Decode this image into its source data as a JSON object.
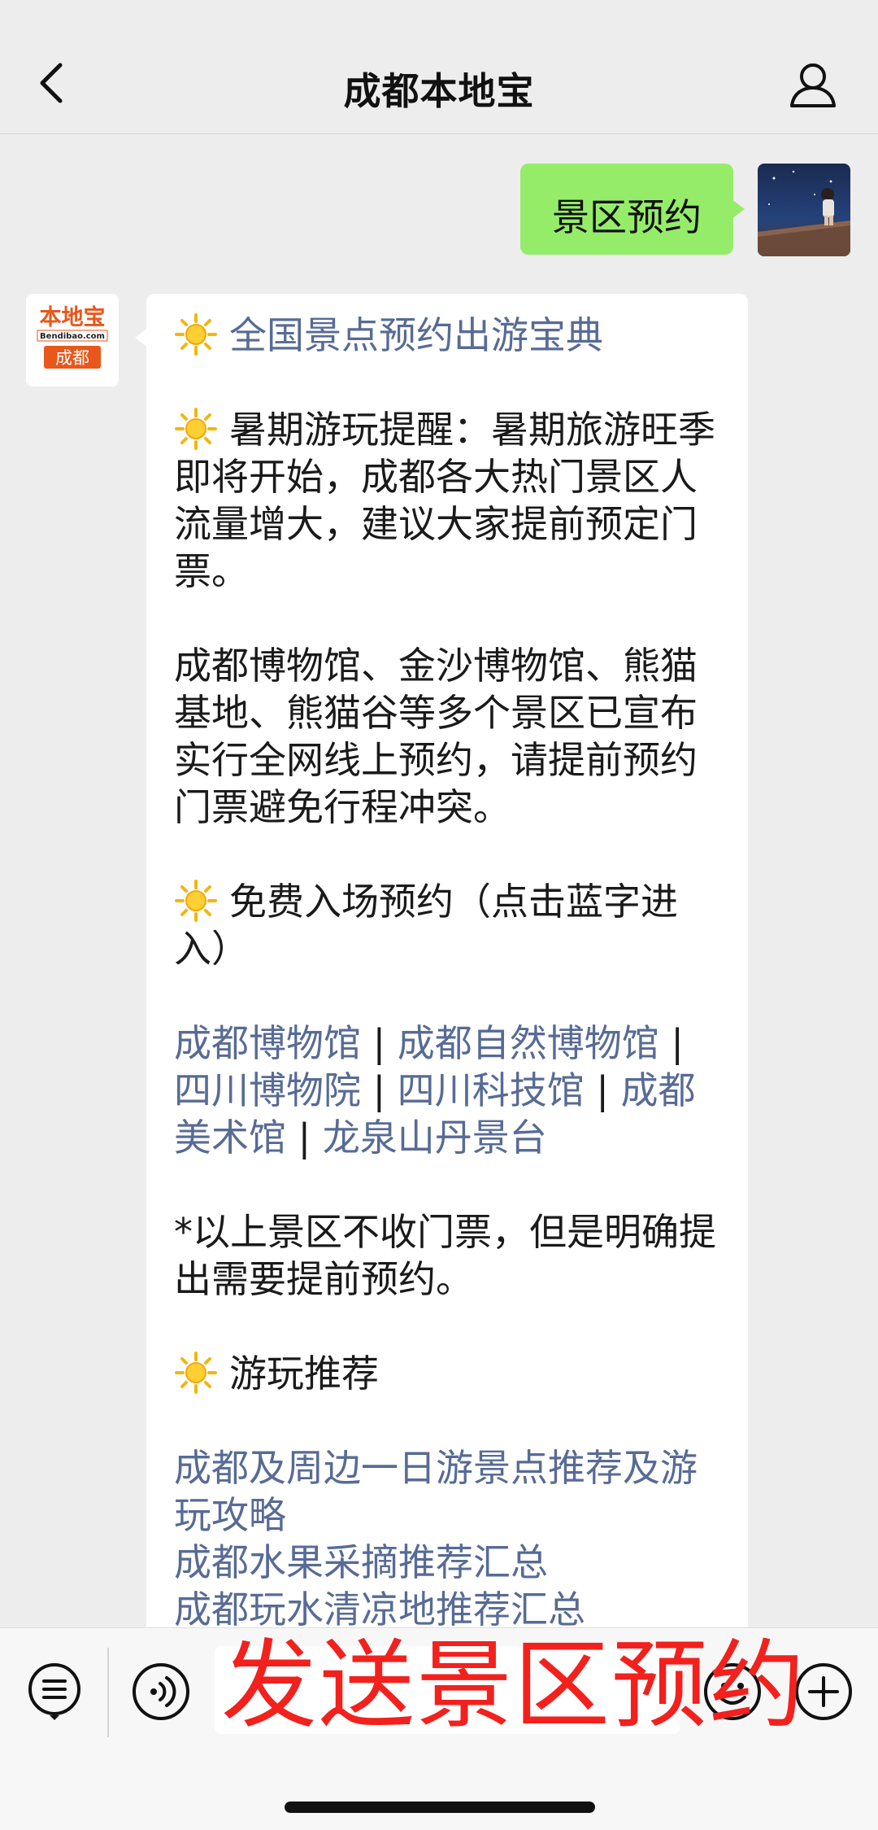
{
  "header": {
    "title": "成都本地宝"
  },
  "chat": {
    "outgoing": {
      "text": "景区预约"
    },
    "bot_avatar": {
      "line1": "本地宝",
      "line2": "Bendibao.com",
      "line3": "成都"
    },
    "incoming": {
      "heading": "全国景点预约出游宝典",
      "reminder": "暑期游玩提醒：暑期旅游旺季即将开始，成都各大热门景区人流量增大，建议大家提前预定门票。",
      "notice": "成都博物馆、金沙博物馆、熊猫基地、熊猫谷等多个景区已宣布实行全网线上预约，请提前预约门票避免行程冲突。",
      "free_title": "免费入场预约（点击蓝字进入）",
      "free_links": [
        "成都博物馆",
        "成都自然博物馆",
        "四川博物院",
        "四川科技馆",
        "成都美术馆",
        "龙泉山丹景台"
      ],
      "separator": "|",
      "free_note": "*以上景区不收门票，但是明确提出需要提前预约。",
      "rec_title": "游玩推荐",
      "rec_links": [
        "成都及周边一日游景点推荐及游玩攻略",
        "成都水果采摘推荐汇总",
        "成都玩水清凉地推荐汇总"
      ]
    }
  },
  "overlay": {
    "text": "发送景区预约"
  },
  "colors": {
    "link": "#576b95",
    "bubble_out": "#95ec69",
    "overlay": "#f2211d",
    "background": "#ededed"
  },
  "icons": {
    "back": "chevron-left-icon",
    "profile": "person-icon",
    "sun": "sun-emoji-icon",
    "menu": "list-icon",
    "voice": "voice-icon",
    "emoji": "emoji-icon",
    "plus": "plus-icon"
  }
}
